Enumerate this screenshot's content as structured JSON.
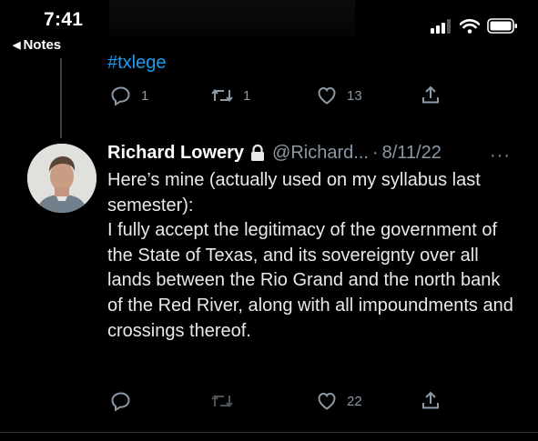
{
  "status_bar": {
    "time": "7:41",
    "back_app": "Notes"
  },
  "previous_tweet": {
    "hashtag": "#txlege",
    "actions": {
      "replies": "1",
      "retweets": "1",
      "likes": "13"
    }
  },
  "tweet": {
    "author_name": "Richard Lowery",
    "handle": "@Richard...",
    "separator": "·",
    "date": "8/11/22",
    "more": "···",
    "lines": [
      "Here’s mine (actually used on my syllabus last semester):",
      "I fully accept the legitimacy of the government of the State of Texas, and its sovereignty over all lands between the Rio Grand and the north bank of the Red River, along with all impoundments and crossings thereof."
    ],
    "actions": {
      "likes": "22"
    }
  },
  "icons": {
    "reply": "reply-icon",
    "retweet": "retweet-icon",
    "like": "heart-icon",
    "share": "share-icon",
    "lock": "lock-icon",
    "back": "back-triangle-icon"
  },
  "colors": {
    "background": "#000000",
    "link": "#1d9bf0",
    "muted": "#8b98a5",
    "text": "#e7e9ea"
  }
}
